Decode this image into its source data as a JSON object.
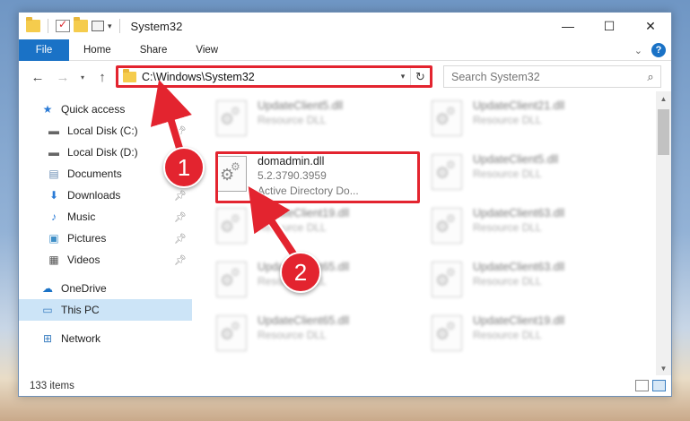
{
  "window": {
    "title": "System32",
    "caption": {
      "minimize": "—",
      "maximize": "☐",
      "close": "✕"
    }
  },
  "ribbon": {
    "tabs": [
      "File",
      "Home",
      "Share",
      "View"
    ],
    "help": "?"
  },
  "nav": {
    "back": "←",
    "forward": "→",
    "recent": "▾",
    "up": "↑",
    "address": "C:\\Windows\\System32",
    "refresh": "↻",
    "search_placeholder": "Search System32"
  },
  "sidebar": {
    "quick_access": "Quick access",
    "items": [
      {
        "label": "Local Disk (C:)",
        "icon": "drive-icon",
        "pinned": true
      },
      {
        "label": "Local Disk (D:)",
        "icon": "drive-icon",
        "pinned": false
      },
      {
        "label": "Documents",
        "icon": "documents-icon",
        "pinned": true
      },
      {
        "label": "Downloads",
        "icon": "downloads-icon",
        "pinned": true
      },
      {
        "label": "Music",
        "icon": "music-icon",
        "pinned": true
      },
      {
        "label": "Pictures",
        "icon": "pictures-icon",
        "pinned": true
      },
      {
        "label": "Videos",
        "icon": "videos-icon",
        "pinned": true
      }
    ],
    "onedrive": "OneDrive",
    "this_pc": "This PC",
    "network": "Network"
  },
  "files": {
    "left": [
      {
        "name": "UpdateClient5.dll",
        "sub": "Resource DLL"
      },
      {
        "name": "domadmin.dll",
        "sub": "5.2.3790.3959",
        "sub2": "Active Directory Do..."
      },
      {
        "name": "UpdateClient19.dll",
        "sub": "Resource DLL"
      },
      {
        "name": "UpdateClient65.dll",
        "sub": "Resource DLL"
      },
      {
        "name": "UpdateClient65.dll",
        "sub": "Resource DLL"
      }
    ],
    "right": [
      {
        "name": "UpdateClient21.dll",
        "sub": "Resource DLL"
      },
      {
        "name": "UpdateClient5.dll",
        "sub": "Resource DLL"
      },
      {
        "name": "UpdateClient63.dll",
        "sub": "Resource DLL"
      },
      {
        "name": "UpdateClient63.dll",
        "sub": "Resource DLL"
      },
      {
        "name": "UpdateClient19.dll",
        "sub": "Resource DLL"
      }
    ]
  },
  "status": {
    "count": "133 items"
  },
  "callouts": [
    "1",
    "2"
  ],
  "colors": {
    "accent": "#1a72c6",
    "highlight": "#e3242f",
    "selected": "#cce4f7"
  }
}
